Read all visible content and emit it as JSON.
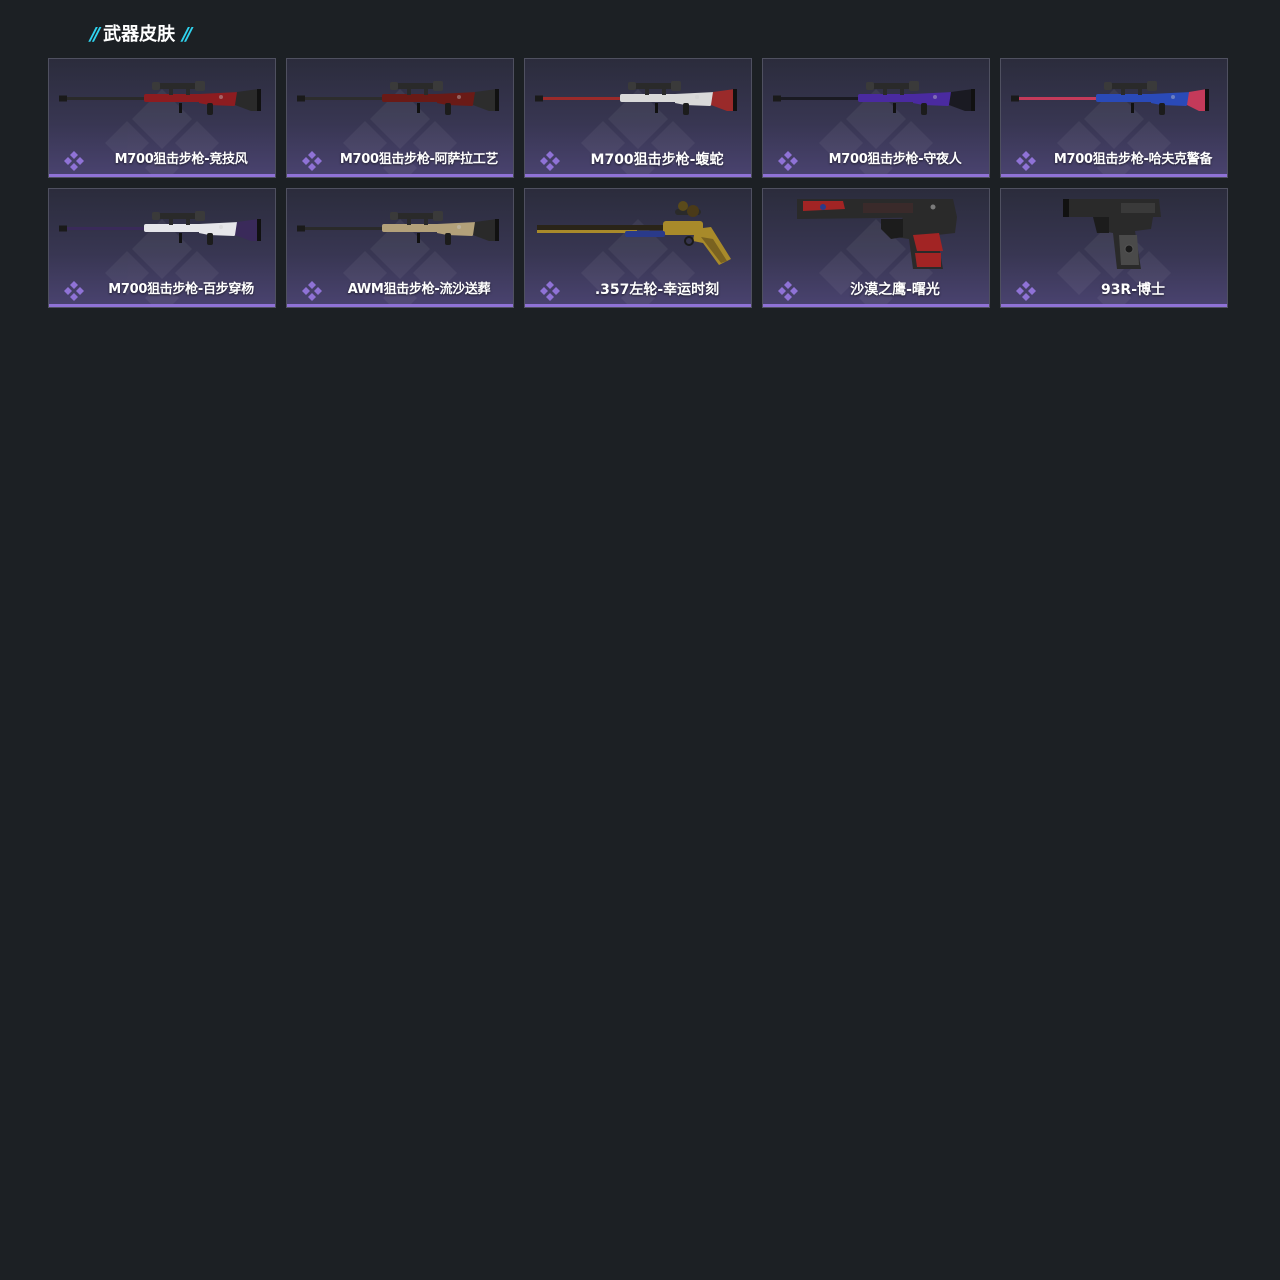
{
  "section": {
    "title": "武器皮肤",
    "left_mark": "//",
    "right_mark": "//"
  },
  "colors": {
    "page_background": "#1c2024",
    "accent_cyan": "#2fd3ee",
    "rarity_purple": "#8f72d6",
    "card_gradient_top": "#2b2c3c",
    "card_gradient_bottom": "#4a4370"
  },
  "skins": [
    {
      "name": "M700狙击步枪-竞技风",
      "weapon_type": "sniper-rifle",
      "skin_colors": [
        "#8d1c20",
        "#2a2a2a"
      ],
      "rarity_icon": "purple-diamond-icon"
    },
    {
      "name": "M700狙击步枪-阿萨拉工艺",
      "weapon_type": "sniper-rifle",
      "skin_colors": [
        "#6a1a16",
        "#2d2d2d"
      ],
      "rarity_icon": "purple-diamond-icon"
    },
    {
      "name": "M700狙击步枪-蝮蛇",
      "weapon_type": "sniper-rifle",
      "skin_colors": [
        "#d9d9d9",
        "#9a2a2a"
      ],
      "rarity_icon": "purple-diamond-icon"
    },
    {
      "name": "M700狙击步枪-守夜人",
      "weapon_type": "sniper-rifle",
      "skin_colors": [
        "#4a2aa0",
        "#1a1a22"
      ],
      "rarity_icon": "purple-diamond-icon"
    },
    {
      "name": "M700狙击步枪-哈夫克警备",
      "weapon_type": "sniper-rifle",
      "skin_colors": [
        "#2a4ab8",
        "#c43a5a"
      ],
      "rarity_icon": "purple-diamond-icon"
    },
    {
      "name": "M700狙击步枪-百步穿杨",
      "weapon_type": "sniper-rifle",
      "skin_colors": [
        "#e6e6ea",
        "#3a2a5a"
      ],
      "rarity_icon": "purple-diamond-icon"
    },
    {
      "name": "AWM狙击步枪-流沙送葬",
      "weapon_type": "sniper-rifle",
      "skin_colors": [
        "#b3a17a",
        "#2a2a2a"
      ],
      "rarity_icon": "purple-diamond-icon"
    },
    {
      "name": ".357左轮-幸运时刻",
      "weapon_type": "revolver",
      "skin_colors": [
        "#a88a2a",
        "#2a3a8a"
      ],
      "rarity_icon": "purple-diamond-icon"
    },
    {
      "name": "沙漠之鹰-曙光",
      "weapon_type": "pistol",
      "skin_colors": [
        "#a22424",
        "#2a2a2a"
      ],
      "rarity_icon": "purple-diamond-icon"
    },
    {
      "name": "93R-博士",
      "weapon_type": "pistol",
      "skin_colors": [
        "#2a2a2a",
        "#4a4a4a"
      ],
      "rarity_icon": "purple-diamond-icon"
    }
  ]
}
